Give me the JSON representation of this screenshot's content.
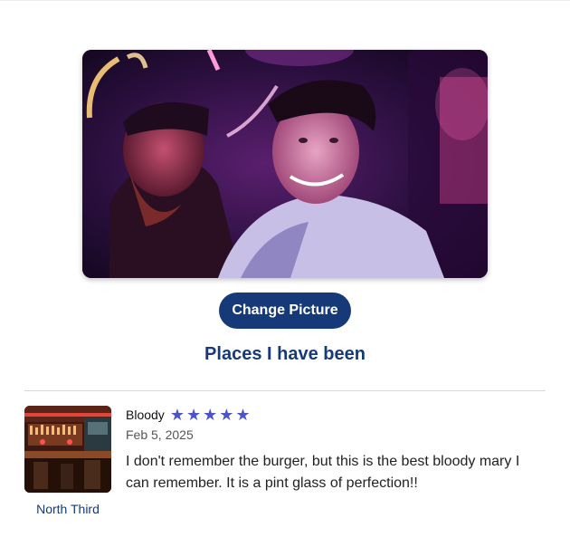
{
  "profile": {
    "change_picture_label": "Change Picture"
  },
  "places_section": {
    "title": "Places I have been"
  },
  "reviews": [
    {
      "title": "Bloody",
      "rating": 5,
      "star_glyph": "★",
      "date": "Feb 5, 2025",
      "text": "I don't remember the burger, but this is the best bloody mary I can remember. It is a pint glass of perfection!!",
      "place": "North Third"
    }
  ],
  "colors": {
    "accent": "#163a78",
    "star": "#4b55c8"
  }
}
